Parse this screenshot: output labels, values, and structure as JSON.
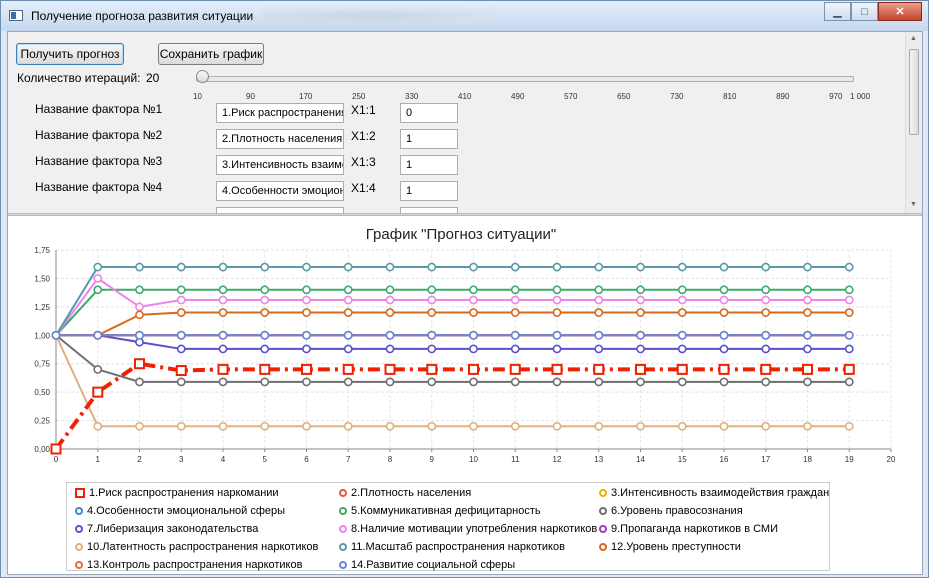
{
  "window": {
    "title": "Получение прогноза развития ситуации",
    "close_glyph": "✕",
    "min_glyph": "▁",
    "max_glyph": "□"
  },
  "toolbar": {
    "get_forecast_label": "Получить прогноз",
    "save_chart_label": "Сохранить график"
  },
  "iterations": {
    "label": "Количество итераций:",
    "value": "20",
    "slider_value": 20,
    "slider_min": 10,
    "slider_max": 1000,
    "ticks": [
      "10",
      "90",
      "170",
      "250",
      "330",
      "410",
      "490",
      "570",
      "650",
      "730",
      "810",
      "890",
      "970",
      "1 000"
    ]
  },
  "factors": [
    {
      "label": "Название фактора №1",
      "name": "1.Риск распространения наркомании",
      "coef_label": "X1:1",
      "coef_value": "0"
    },
    {
      "label": "Название фактора №2",
      "name": "2.Плотность населения",
      "coef_label": "X1:2",
      "coef_value": "1"
    },
    {
      "label": "Название фактора №3",
      "name": "3.Интенсивность взаимодействия граждан",
      "coef_label": "X1:3",
      "coef_value": "1"
    },
    {
      "label": "Название фактора №4",
      "name": "4.Особенности эмоциональной сферы",
      "coef_label": "X1:4",
      "coef_value": "1"
    }
  ],
  "chart_data": {
    "type": "line",
    "title": "График \"Прогноз ситуации\"",
    "xlabel": "",
    "ylabel": "",
    "xlim": [
      0,
      20
    ],
    "ylim": [
      0,
      1.75
    ],
    "x_ticks": [
      "0",
      "1",
      "2",
      "3",
      "4",
      "5",
      "6",
      "7",
      "8",
      "9",
      "10",
      "11",
      "12",
      "13",
      "14",
      "15",
      "16",
      "17",
      "18",
      "19",
      "20"
    ],
    "y_ticks": [
      "0,00",
      "0,25",
      "0,50",
      "0,75",
      "1,00",
      "1,25",
      "1,50",
      "1,75"
    ],
    "grid": true,
    "legend_position": "bottom",
    "series": [
      {
        "name": "1.Риск распространения наркомании",
        "color": "#ee2200",
        "marker": "square",
        "dashed": true,
        "values": [
          0,
          0.5,
          0.75,
          0.69,
          0.7,
          0.7,
          0.7,
          0.7,
          0.7,
          0.7,
          0.7,
          0.7,
          0.7,
          0.7,
          0.7,
          0.7,
          0.7,
          0.7,
          0.7,
          0.7
        ]
      },
      {
        "name": "2.Плотность населения",
        "color": "#e05a4a",
        "marker": "circle",
        "values": [
          1,
          1,
          1,
          1,
          1,
          1,
          1,
          1,
          1,
          1,
          1,
          1,
          1,
          1,
          1,
          1,
          1,
          1,
          1,
          1
        ]
      },
      {
        "name": "3.Интенсивность взаимодействия граждан",
        "color": "#f0b000",
        "marker": "circle",
        "values": [
          1,
          1,
          1,
          1,
          1,
          1,
          1,
          1,
          1,
          1,
          1,
          1,
          1,
          1,
          1,
          1,
          1,
          1,
          1,
          1
        ]
      },
      {
        "name": "4.Особенности эмоциональной сферы",
        "color": "#3a86d6",
        "marker": "circle",
        "values": [
          1,
          1,
          1,
          1,
          1,
          1,
          1,
          1,
          1,
          1,
          1,
          1,
          1,
          1,
          1,
          1,
          1,
          1,
          1,
          1
        ]
      },
      {
        "name": "5.Коммуникативная дефицитарность",
        "color": "#3daa6a",
        "marker": "circle",
        "values": [
          1,
          1.4,
          1.4,
          1.4,
          1.4,
          1.4,
          1.4,
          1.4,
          1.4,
          1.4,
          1.4,
          1.4,
          1.4,
          1.4,
          1.4,
          1.4,
          1.4,
          1.4,
          1.4,
          1.4
        ]
      },
      {
        "name": "6.Уровень правосознания",
        "color": "#6e6e6e",
        "marker": "circle",
        "values": [
          1,
          0.7,
          0.59,
          0.59,
          0.59,
          0.59,
          0.59,
          0.59,
          0.59,
          0.59,
          0.59,
          0.59,
          0.59,
          0.59,
          0.59,
          0.59,
          0.59,
          0.59,
          0.59,
          0.59
        ]
      },
      {
        "name": "7.Либеризация законодательства",
        "color": "#5b4fd0",
        "marker": "circle",
        "values": [
          1,
          1,
          0.94,
          0.88,
          0.88,
          0.88,
          0.88,
          0.88,
          0.88,
          0.88,
          0.88,
          0.88,
          0.88,
          0.88,
          0.88,
          0.88,
          0.88,
          0.88,
          0.88,
          0.88
        ]
      },
      {
        "name": "8.Наличие мотивации употребления наркотиков",
        "color": "#ee82ee",
        "marker": "circle",
        "values": [
          1,
          1.5,
          1.25,
          1.31,
          1.31,
          1.31,
          1.31,
          1.31,
          1.31,
          1.31,
          1.31,
          1.31,
          1.31,
          1.31,
          1.31,
          1.31,
          1.31,
          1.31,
          1.31,
          1.31
        ]
      },
      {
        "name": "9.Пропаганда наркотиков в СМИ",
        "color": "#9a3ac8",
        "marker": "circle",
        "values": [
          1,
          1,
          1,
          1,
          1,
          1,
          1,
          1,
          1,
          1,
          1,
          1,
          1,
          1,
          1,
          1,
          1,
          1,
          1,
          1
        ]
      },
      {
        "name": "10.Латентность распространения наркотиков",
        "color": "#e0b080",
        "marker": "circle",
        "values": [
          1,
          0.2,
          0.2,
          0.2,
          0.2,
          0.2,
          0.2,
          0.2,
          0.2,
          0.2,
          0.2,
          0.2,
          0.2,
          0.2,
          0.2,
          0.2,
          0.2,
          0.2,
          0.2,
          0.2
        ]
      },
      {
        "name": "11.Масштаб распространения наркотиков",
        "color": "#5a9aa8",
        "marker": "circle",
        "values": [
          1,
          1.6,
          1.6,
          1.6,
          1.6,
          1.6,
          1.6,
          1.6,
          1.6,
          1.6,
          1.6,
          1.6,
          1.6,
          1.6,
          1.6,
          1.6,
          1.6,
          1.6,
          1.6,
          1.6
        ]
      },
      {
        "name": "12.Уровень преступности",
        "color": "#d86a1a",
        "marker": "circle",
        "values": [
          1,
          1,
          1.18,
          1.2,
          1.2,
          1.2,
          1.2,
          1.2,
          1.2,
          1.2,
          1.2,
          1.2,
          1.2,
          1.2,
          1.2,
          1.2,
          1.2,
          1.2,
          1.2,
          1.2
        ]
      },
      {
        "name": "13.Контроль распространения наркотиков",
        "color": "#e07040",
        "marker": "circle",
        "values": [
          1,
          1,
          1,
          1,
          1,
          1,
          1,
          1,
          1,
          1,
          1,
          1,
          1,
          1,
          1,
          1,
          1,
          1,
          1,
          1
        ]
      },
      {
        "name": "14.Развитие социальной сферы",
        "color": "#6a86d8",
        "marker": "circle",
        "values": [
          1,
          1,
          1,
          1,
          1,
          1,
          1,
          1,
          1,
          1,
          1,
          1,
          1,
          1,
          1,
          1,
          1,
          1,
          1,
          1
        ]
      }
    ]
  }
}
